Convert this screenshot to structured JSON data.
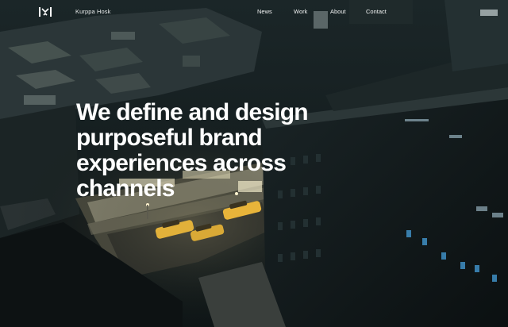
{
  "header": {
    "logo_icon": "kurppa-hosk-logo-icon",
    "brand_name": "Kurppa Hosk",
    "nav": [
      {
        "label": "News"
      },
      {
        "label": "Work"
      },
      {
        "label": "About"
      },
      {
        "label": "Contact"
      }
    ]
  },
  "hero": {
    "headline_lines": [
      "We define and design",
      "purposeful brand",
      "experiences across",
      "channels"
    ]
  },
  "colors": {
    "text": "#ffffff",
    "background_dark": "#0c1112",
    "street_light": "#f3e2b0",
    "taxi_yellow": "#e8b43a"
  }
}
